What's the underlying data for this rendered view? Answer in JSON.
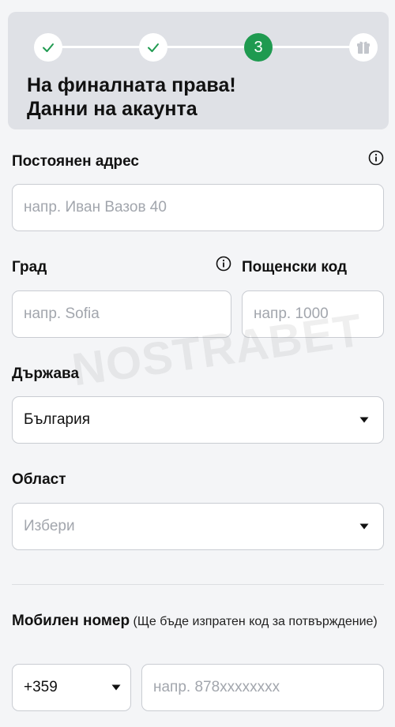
{
  "stepper": {
    "current_step": "3",
    "steps_completed": 2,
    "total_steps": 4
  },
  "header": {
    "title_line1": "На финалната права!",
    "title_line2": "Данни на акаунта"
  },
  "address": {
    "label": "Постоянен адрес",
    "placeholder": "напр. Иван Вазов 40"
  },
  "city": {
    "label": "Град",
    "placeholder": "напр. Sofia"
  },
  "postal_code": {
    "label": "Пощенски код",
    "placeholder": "напр. 1000"
  },
  "country": {
    "label": "Държава",
    "selected": "България"
  },
  "region": {
    "label": "Област",
    "placeholder": "Избери"
  },
  "mobile": {
    "label": "Мобилен номер",
    "note": "(Ще бъде изпратен код за потвърждение)",
    "country_code": "+359",
    "placeholder": "напр. 878xxxxxxxx"
  },
  "watermark": "NOSTRABET",
  "colors": {
    "accent": "#1f9a50",
    "header_bg": "#dfe1e6",
    "page_bg": "#f4f5f7"
  }
}
